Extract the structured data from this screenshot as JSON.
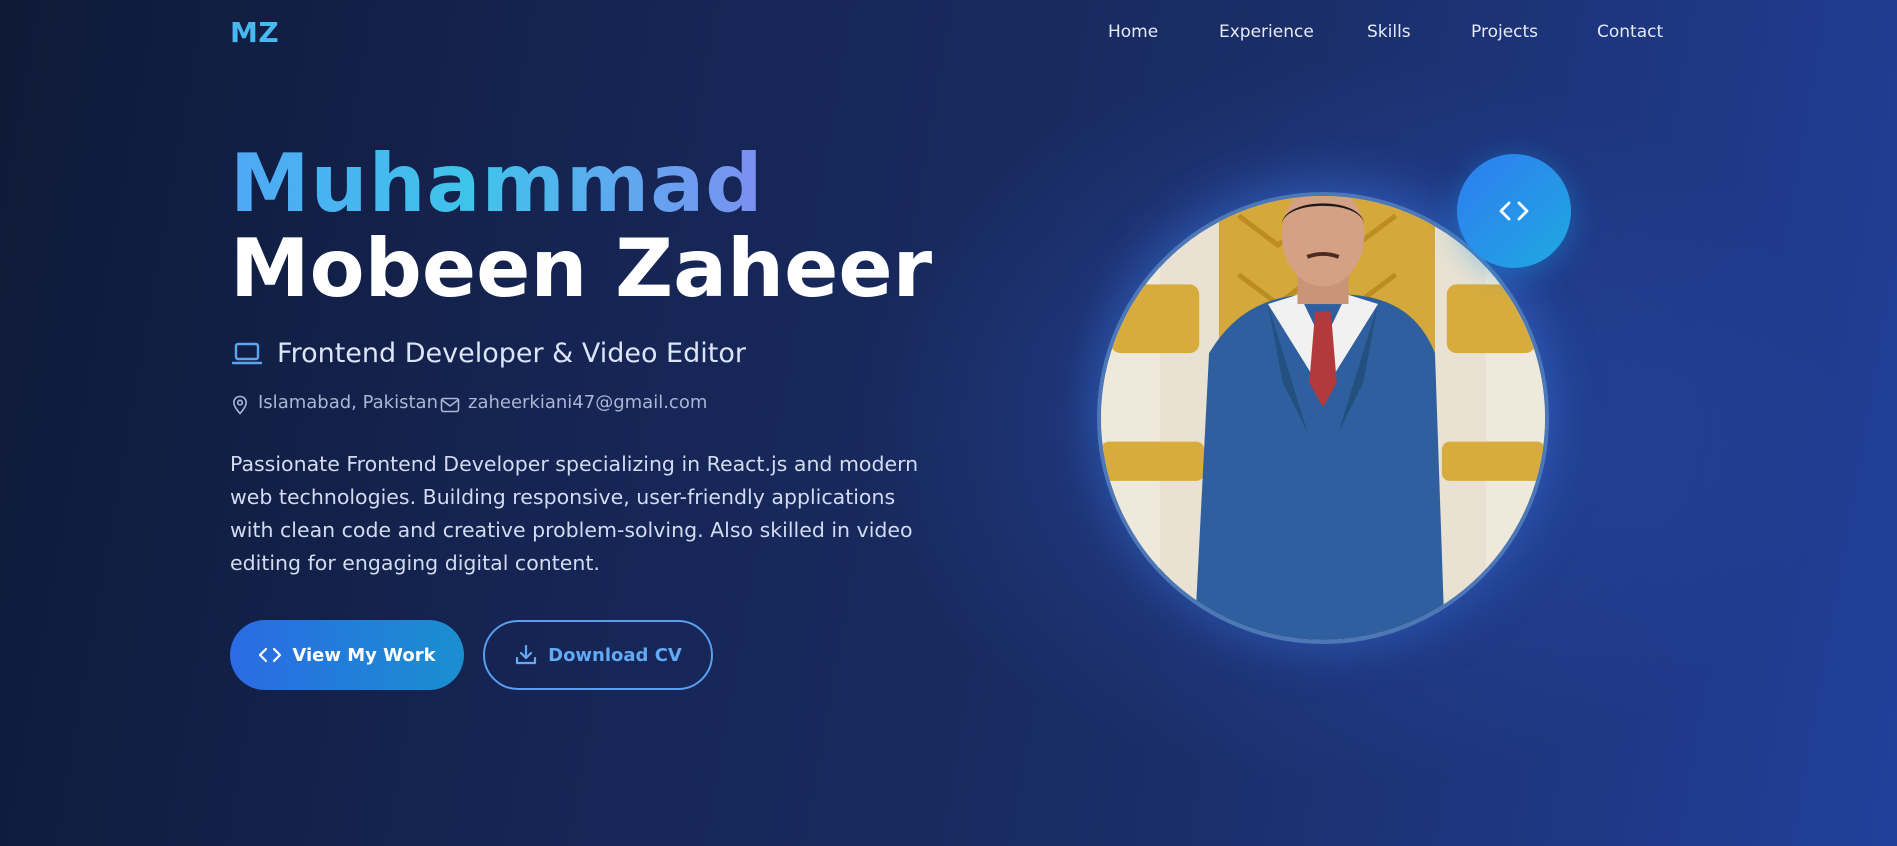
{
  "nav": {
    "logo": "MZ",
    "links": [
      "Home",
      "Experience",
      "Skills",
      "Projects",
      "Contact"
    ]
  },
  "hero": {
    "first_name": "Muhammad",
    "last_name": "Mobeen Zaheer",
    "role": "Frontend Developer & Video Editor",
    "location": "Islamabad, Pakistan",
    "email": "zaheerkiani47@gmail.com",
    "bio": "Passionate Frontend Developer specializing in React.js and modern web technologies. Building responsive, user-friendly applications with clean code and creative problem-solving. Also skilled in video editing for engaging digital content.",
    "buttons": {
      "primary": "View My Work",
      "secondary": "Download CV"
    }
  },
  "icons": {
    "role": "laptop-icon",
    "location": "map-pin-icon",
    "email": "mail-icon",
    "primary_button": "code-icon",
    "secondary_button": "download-icon",
    "badge": "code-icon"
  },
  "colors": {
    "accent": "#48b8f0",
    "primary_button_start": "#2a6be4",
    "primary_button_end": "#1a8fcf",
    "outline_button": "#5a9ef0",
    "background_dark": "#0f1a38",
    "background_light": "#21409a"
  }
}
